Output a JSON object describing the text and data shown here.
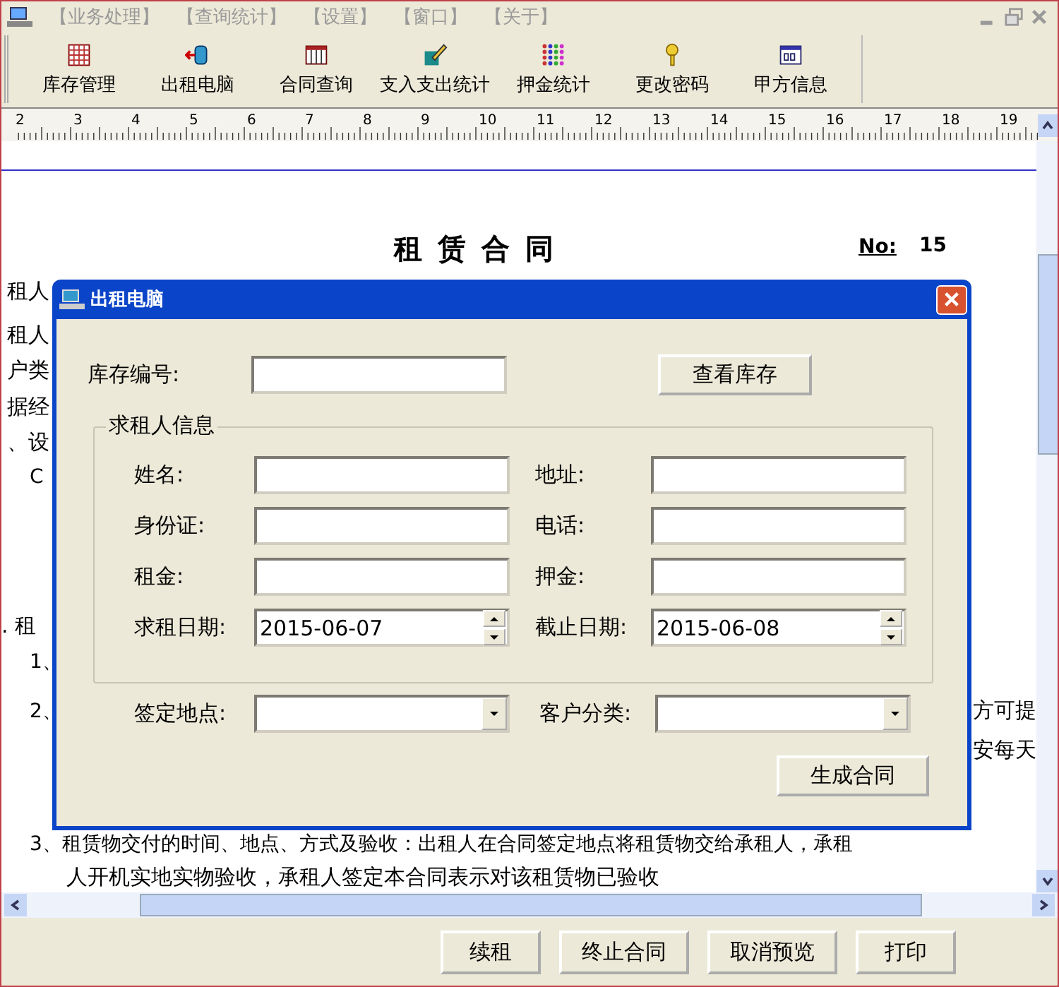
{
  "menu": [
    "【业务处理】",
    "【查询统计】",
    "【设置】",
    "【窗口】",
    "【关于】"
  ],
  "toolbar": [
    "库存管理",
    "出租电脑",
    "合同查询",
    "支入支出统计",
    "押金统计",
    "更改密码",
    "甲方信息"
  ],
  "ruler": [
    "2",
    "3",
    "4",
    "5",
    "6",
    "7",
    "8",
    "9",
    "10",
    "11",
    "12",
    "13",
    "14",
    "15",
    "16",
    "17",
    "18",
    "19"
  ],
  "document": {
    "title": "租 赁 合 同",
    "number_label": "No:",
    "number": "15",
    "lines": [
      {
        "kind": "edge",
        "text": "租人"
      },
      {
        "kind": "edge",
        "text": "租人"
      },
      {
        "kind": "edge",
        "text": "户类"
      },
      {
        "kind": "edge",
        "text": "据经"
      },
      {
        "kind": "edge",
        "text": "、设"
      },
      {
        "kind": "sub",
        "text": "C"
      },
      {
        "kind": "section",
        "text": ". 租"
      },
      {
        "kind": "sub",
        "text": "1、"
      },
      {
        "kind": "sub",
        "text": "2、",
        "right": "方可提"
      },
      {
        "kind": "right",
        "right": "安每天"
      },
      {
        "kind": "sub",
        "text": "3、租赁物交付的时间、地点、方式及验收：出租人在合同签定地点将租赁物交给承租人，承租"
      },
      {
        "kind": "cont",
        "text": "人开机实地实物验收，承租人签定本合同表示对该租赁物已验收"
      }
    ]
  },
  "dialog": {
    "title": "出租电脑",
    "stock_label": "库存编号:",
    "stock_button": "查看库存",
    "group_title": "求租人信息",
    "group_fields": [
      {
        "label": "姓名:",
        "kind": "text"
      },
      {
        "label": "地址:",
        "kind": "text"
      },
      {
        "label": "身份证:",
        "kind": "text"
      },
      {
        "label": "电话:",
        "kind": "text"
      },
      {
        "label": "租金:",
        "kind": "text"
      },
      {
        "label": "押金:",
        "kind": "text"
      },
      {
        "label": "求租日期:",
        "kind": "spin",
        "value": "2015-06-07"
      },
      {
        "label": "截止日期:",
        "kind": "spin",
        "value": "2015-06-08"
      }
    ],
    "bottom_fields": [
      {
        "label": "签定地点:",
        "kind": "dropdown"
      },
      {
        "label": "客户分类:",
        "kind": "dropdown"
      }
    ],
    "submit": "生成合同"
  },
  "actions": [
    "续租",
    "终止合同",
    "取消预览",
    "打印"
  ]
}
